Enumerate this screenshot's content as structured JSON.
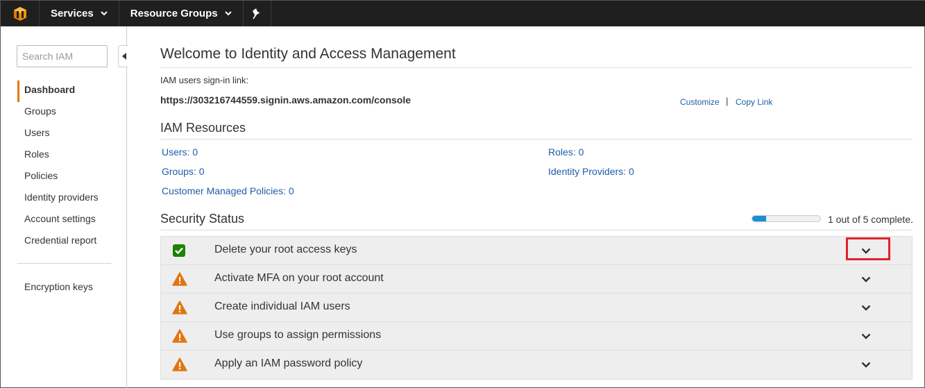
{
  "topbar": {
    "services_label": "Services",
    "resource_groups_label": "Resource Groups"
  },
  "sidebar": {
    "search_placeholder": "Search IAM",
    "items": [
      {
        "label": "Dashboard",
        "active": true
      },
      {
        "label": "Groups"
      },
      {
        "label": "Users"
      },
      {
        "label": "Roles"
      },
      {
        "label": "Policies"
      },
      {
        "label": "Identity providers"
      },
      {
        "label": "Account settings"
      },
      {
        "label": "Credential report"
      }
    ],
    "extra_item": "Encryption keys"
  },
  "main": {
    "title": "Welcome to Identity and Access Management",
    "signin_label": "IAM users sign-in link:",
    "signin_url": "https://303216744559.signin.aws.amazon.com/console",
    "customize_label": "Customize",
    "divider": "|",
    "copy_link_label": "Copy Link",
    "resources_title": "IAM Resources",
    "resources": {
      "users": "Users: 0",
      "roles": "Roles: 0",
      "groups": "Groups: 0",
      "identity_providers": "Identity Providers: 0",
      "customer_managed_policies": "Customer Managed Policies: 0"
    },
    "security_title": "Security Status",
    "progress": {
      "completed": 1,
      "total": 5,
      "text": "1 out of 5 complete."
    },
    "status_items": [
      {
        "label": "Delete your root access keys",
        "status": "complete",
        "icon": "check-icon"
      },
      {
        "label": "Activate MFA on your root account",
        "status": "warning",
        "icon": "warning-icon"
      },
      {
        "label": "Create individual IAM users",
        "status": "warning",
        "icon": "warning-icon"
      },
      {
        "label": "Use groups to assign permissions",
        "status": "warning",
        "icon": "warning-icon"
      },
      {
        "label": "Apply an IAM password policy",
        "status": "warning",
        "icon": "warning-icon"
      }
    ]
  },
  "colors": {
    "accent": "#e07b00",
    "link": "#1f5ca8",
    "progress_fill": "#1a8fd6",
    "success": "#1d8102",
    "warning": "#e0760f",
    "highlight": "#e0202a"
  }
}
